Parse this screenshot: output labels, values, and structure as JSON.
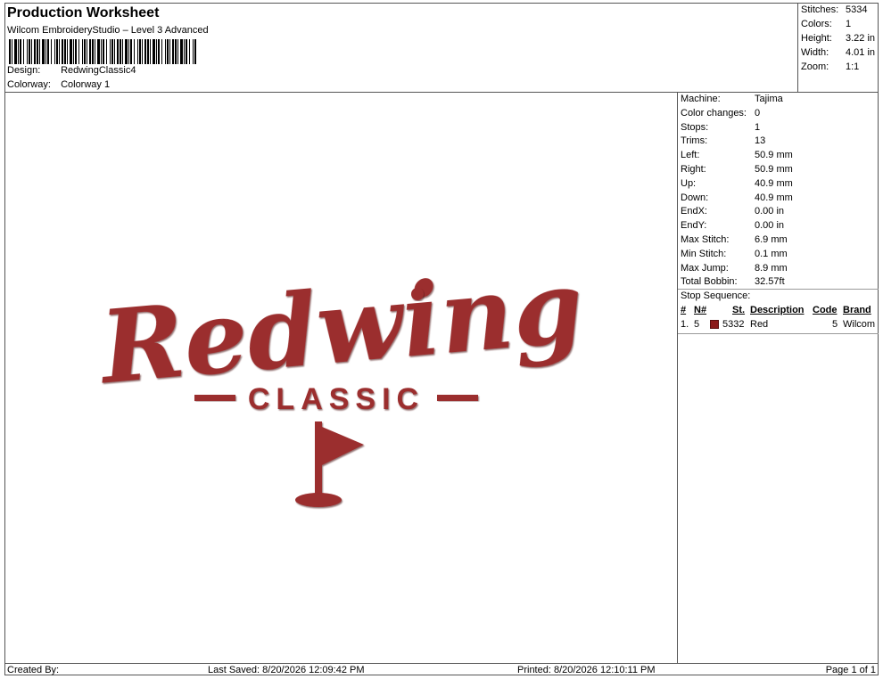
{
  "header": {
    "title": "Production Worksheet",
    "subtitle": "Wilcom EmbroideryStudio – Level 3 Advanced",
    "design_label": "Design:",
    "design_value": "RedwingClassic4",
    "colorway_label": "Colorway:",
    "colorway_value": "Colorway 1"
  },
  "summary": {
    "stitches_label": "Stitches:",
    "stitches_value": "5334",
    "colors_label": "Colors:",
    "colors_value": "1",
    "height_label": "Height:",
    "height_value": "3.22 in",
    "width_label": "Width:",
    "width_value": "4.01 in",
    "zoom_label": "Zoom:",
    "zoom_value": "1:1"
  },
  "design": {
    "script_text": "Redwing",
    "block_text": "CLASSIC",
    "thread_color": "#9b2d2d"
  },
  "info": {
    "rows": [
      {
        "k": "Machine:",
        "v": "Tajima"
      },
      {
        "k": "Color changes:",
        "v": "0"
      },
      {
        "k": "Stops:",
        "v": "1"
      },
      {
        "k": "Trims:",
        "v": "13"
      },
      {
        "k": "Left:",
        "v": "50.9 mm"
      },
      {
        "k": "Right:",
        "v": "50.9 mm"
      },
      {
        "k": "Up:",
        "v": "40.9 mm"
      },
      {
        "k": "Down:",
        "v": "40.9 mm"
      },
      {
        "k": "EndX:",
        "v": "0.00 in"
      },
      {
        "k": "EndY:",
        "v": "0.00 in"
      },
      {
        "k": "Max Stitch:",
        "v": "6.9 mm"
      },
      {
        "k": "Min Stitch:",
        "v": "0.1 mm"
      },
      {
        "k": "Max Jump:",
        "v": "8.9 mm"
      },
      {
        "k": "Total Bobbin:",
        "v": "32.57ft"
      }
    ],
    "stop_sequence_label": "Stop Sequence:",
    "stop_headers": {
      "num": "#",
      "n": "N#",
      "st": "St.",
      "desc": "Description",
      "code": "Code",
      "brand": "Brand"
    },
    "stop_row": {
      "num": "1.",
      "n": "5",
      "st": "5332",
      "desc": "Red",
      "code": "5",
      "brand": "Wilcom",
      "swatch": "#8b1a1a"
    }
  },
  "footer": {
    "created": "Created By:",
    "saved": "Last Saved: 8/20/2026 12:09:42 PM",
    "printed": "Printed: 8/20/2026 12:10:11 PM",
    "page": "Page 1 of 1"
  }
}
